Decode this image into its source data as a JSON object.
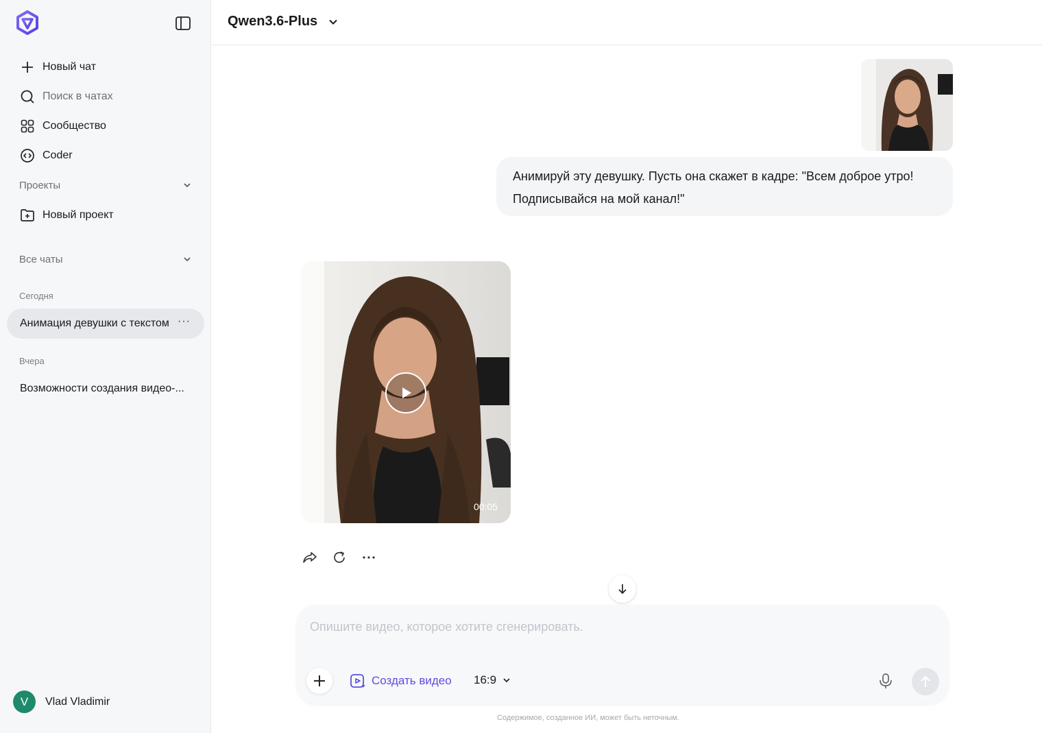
{
  "sidebar": {
    "nav": [
      {
        "label": "Новый чат",
        "icon": "plus-icon"
      },
      {
        "label": "Поиск в чатах",
        "icon": "search-icon"
      },
      {
        "label": "Сообщество",
        "icon": "grid-icon"
      },
      {
        "label": "Coder",
        "icon": "code-icon"
      }
    ],
    "projects_label": "Проекты",
    "new_project_label": "Новый проект",
    "all_chats_label": "Все чаты",
    "today_label": "Сегодня",
    "yesterday_label": "Вчера",
    "chats_today": [
      {
        "title": "Анимация девушки с текстом"
      }
    ],
    "chats_yesterday": [
      {
        "title": "Возможности создания видео-..."
      }
    ],
    "user": {
      "initial": "V",
      "name": "Vlad Vladimir",
      "avatar_color": "#1e8a6b"
    }
  },
  "header": {
    "model": "Qwen3.6-Plus"
  },
  "conversation": {
    "user_message": "Анимируй эту девушку. Пусть она скажет в кадре: \"Всем доброе утро! Подписывайся на мой канал!\"",
    "video": {
      "duration": "00:05"
    }
  },
  "composer": {
    "placeholder": "Опишите видео, которое хотите сгенерировать.",
    "create_video_label": "Создать видео",
    "aspect_ratio": "16:9",
    "accent_color": "#5b4ee0"
  },
  "disclaimer": "Содержимое, созданное ИИ, может быть неточным."
}
